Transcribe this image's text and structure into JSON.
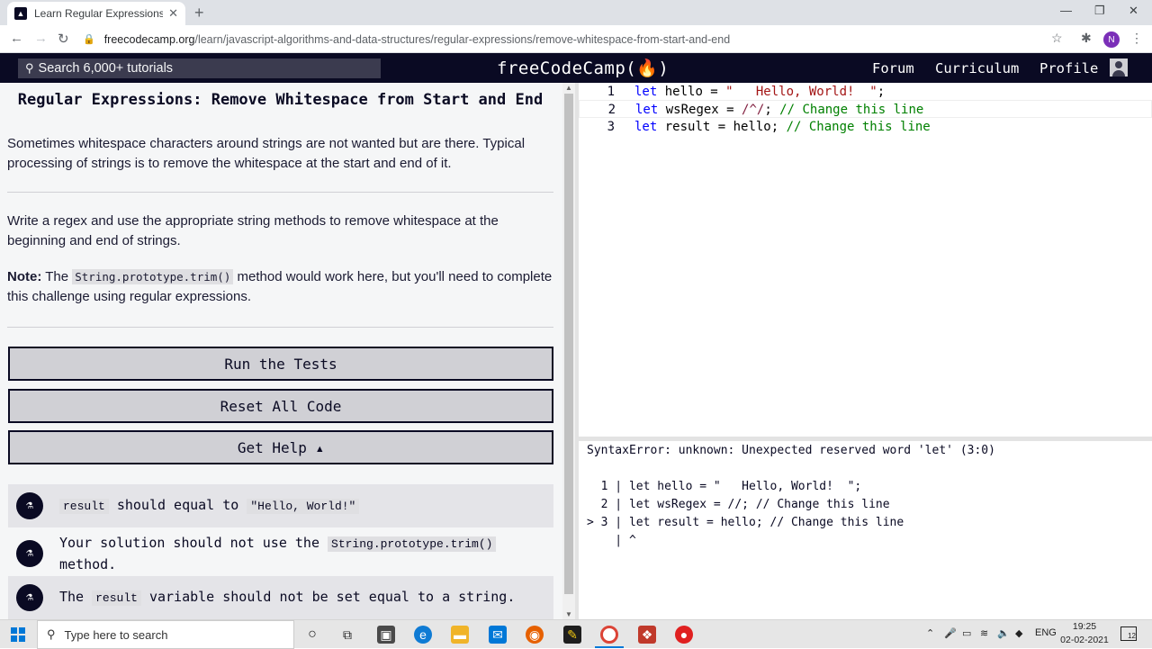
{
  "browser": {
    "tab_title": "Learn Regular Expressions: Remo",
    "url_host": "freecodecamp.org",
    "url_path": "/learn/javascript-algorithms-and-data-structures/regular-expressions/remove-whitespace-from-start-and-end",
    "profile_initial": "N"
  },
  "nav": {
    "search_placeholder": "Search 6,000+ tutorials",
    "brand": "freeCodeCamp(🔥)",
    "forum": "Forum",
    "curriculum": "Curriculum",
    "profile": "Profile"
  },
  "challenge": {
    "title": "Regular Expressions: Remove Whitespace from Start and End",
    "intro": "Sometimes whitespace characters around strings are not wanted but are there. Typical processing of strings is to remove the whitespace at the start and end of it.",
    "instructions": "Write a regex and use the appropriate string methods to remove whitespace at the beginning and end of strings.",
    "note_label": "Note:",
    "note_pre": " The ",
    "note_code": "String.prototype.trim()",
    "note_post": " method would work here, but you'll need to complete this challenge using regular expressions."
  },
  "buttons": {
    "run": "Run the Tests",
    "reset": "Reset All Code",
    "help": "Get Help ▴"
  },
  "tests": [
    {
      "code1": "result",
      "text1": " should equal to ",
      "code2": "\"Hello, World!\""
    },
    {
      "text1": "Your solution should not use the ",
      "code1": "String.prototype.trim()",
      "text2": " method."
    },
    {
      "text1": "The ",
      "code1": "result",
      "text2": " variable should not be set equal to a string."
    }
  ],
  "editor": {
    "lines": [
      {
        "num": "1",
        "kw": "let",
        "name": " hello = ",
        "str": "\"   Hello, World!  \"",
        "tail": ";"
      },
      {
        "num": "2",
        "kw": "let",
        "name": " wsRegex = ",
        "rgx": "/^/",
        "tail": "; ",
        "cmt": "// Change this line"
      },
      {
        "num": "3",
        "kw": "let",
        "name": " result = hello; ",
        "cmt": "// Change this line"
      }
    ]
  },
  "console": {
    "error": "SyntaxError: unknown: Unexpected reserved word 'let' (3:0)",
    "frame": [
      "  1 | let hello = \"   Hello, World!  \";",
      "  2 | let wsRegex = //; // Change this line",
      "> 3 | let result = hello; // Change this line",
      "    | ^"
    ]
  },
  "taskbar": {
    "search_placeholder": "Type here to search",
    "lang": "ENG",
    "time": "19:25",
    "date": "02-02-2021",
    "notif_count": "12"
  }
}
